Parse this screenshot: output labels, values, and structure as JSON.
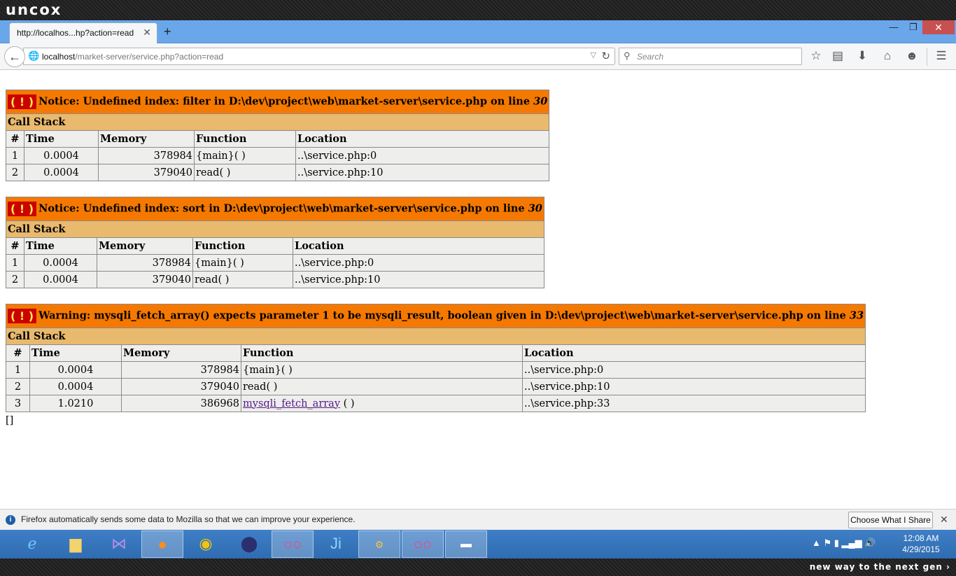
{
  "brand": {
    "logo": "uncox",
    "slogan": "new way to the next gen ›"
  },
  "browser": {
    "tab_title": "http://localhos...hp?action=read",
    "tab_close": "✕",
    "new_tab": "+",
    "win_min": "—",
    "win_max": "❐",
    "win_close": "✕",
    "url_host": "localhost",
    "url_path": "/market-server/service.php?action=read",
    "search_placeholder": "Search"
  },
  "errors": [
    {
      "badge": "( ! )",
      "message": "Notice: Undefined index: filter in D:\\dev\\project\\web\\market-server\\service.php on line ",
      "line": "30",
      "call_stack_label": "Call Stack",
      "columns": [
        "#",
        "Time",
        "Memory",
        "Function",
        "Location"
      ],
      "rows": [
        {
          "n": "1",
          "time": "0.0004",
          "memory": "378984",
          "func": "{main}( )",
          "loc": "..\\service.php:0"
        },
        {
          "n": "2",
          "time": "0.0004",
          "memory": "379040",
          "func": "read( )",
          "loc": "..\\service.php:10"
        }
      ]
    },
    {
      "badge": "( ! )",
      "message": "Notice: Undefined index: sort in D:\\dev\\project\\web\\market-server\\service.php on line ",
      "line": "30",
      "call_stack_label": "Call Stack",
      "columns": [
        "#",
        "Time",
        "Memory",
        "Function",
        "Location"
      ],
      "rows": [
        {
          "n": "1",
          "time": "0.0004",
          "memory": "378984",
          "func": "{main}( )",
          "loc": "..\\service.php:0"
        },
        {
          "n": "2",
          "time": "0.0004",
          "memory": "379040",
          "func": "read( )",
          "loc": "..\\service.php:10"
        }
      ]
    },
    {
      "badge": "( ! )",
      "message": "Warning: mysqli_fetch_array() expects parameter 1 to be mysqli_result, boolean given in D:\\dev\\project\\web\\market-server\\service.php on line ",
      "line": "33",
      "call_stack_label": "Call Stack",
      "columns": [
        "#",
        "Time",
        "Memory",
        "Function",
        "Location"
      ],
      "rows": [
        {
          "n": "1",
          "time": "0.0004",
          "memory": "378984",
          "func": "{main}( )",
          "loc": "..\\service.php:0"
        },
        {
          "n": "2",
          "time": "0.0004",
          "memory": "379040",
          "func": "read( )",
          "loc": "..\\service.php:10"
        },
        {
          "n": "3",
          "time": "1.0210",
          "memory": "386968",
          "func_link": "mysqli_fetch_array",
          "func_suffix": " ( )",
          "loc": "..\\service.php:33"
        }
      ]
    }
  ],
  "json_output": "[]",
  "notification": {
    "text": "Firefox automatically sends some data to Mozilla so that we can improve your experience.",
    "button": "Choose What I Share",
    "close": "✕"
  },
  "taskbar": {
    "clock_time": "12:08 AM",
    "clock_date": "4/29/2015",
    "icons": [
      "ie-icon",
      "file-explorer-icon",
      "visual-studio-icon",
      "firefox-icon",
      "chrome-icon",
      "eclipse-icon",
      "flickr-icon",
      "intellij-icon",
      "javaee-ide-icon",
      "flickr-icon",
      "command-prompt-icon"
    ]
  }
}
